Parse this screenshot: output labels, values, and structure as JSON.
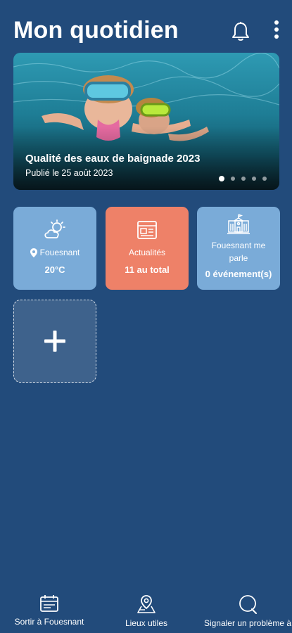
{
  "header": {
    "title": "Mon quotidien"
  },
  "banner": {
    "title": "Qualité des eaux de baignade 2023",
    "subtitle": "Publié le 25 août 2023",
    "slide_count": 5,
    "active_slide": 1
  },
  "tiles": {
    "weather": {
      "location": "Fouesnant",
      "temperature": "20°C",
      "icon": "partly-cloudy-icon",
      "color": "#7aabd8"
    },
    "news": {
      "label": "Actualités",
      "count_text": "11 au total",
      "icon": "newspaper-icon",
      "color": "#ee8168"
    },
    "city": {
      "label": "Fouesnant me parle",
      "events_text": "0 événement(s)",
      "icon": "town-hall-icon",
      "color": "#7aabd8"
    },
    "add": {
      "icon": "plus-icon"
    }
  },
  "bottom_nav": [
    {
      "label": "Sortir à Fouesnant",
      "icon": "calendar-icon"
    },
    {
      "label": "Lieux utiles",
      "icon": "map-pin-icon"
    },
    {
      "label": "Signaler un problème à",
      "icon": "chat-bubble-icon"
    }
  ],
  "colors": {
    "background": "#224b7b",
    "tile_blue": "#7aabd8",
    "tile_orange": "#ee8168"
  }
}
